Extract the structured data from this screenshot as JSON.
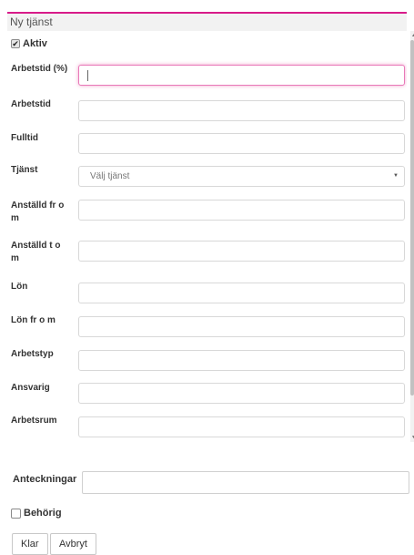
{
  "dialog": {
    "title": "Ny tjänst"
  },
  "form": {
    "active": {
      "label": "Aktiv",
      "checked": true
    },
    "fields": [
      {
        "label": "Arbetstid (%)",
        "value": "",
        "type": "text",
        "focused": true
      },
      {
        "label": "Arbetstid",
        "value": "",
        "type": "text"
      },
      {
        "label": "Fulltid",
        "value": "",
        "type": "text"
      },
      {
        "label": "Tjänst",
        "value": "Välj tjänst",
        "type": "select"
      },
      {
        "label": "Anställd fr o m",
        "value": "",
        "type": "text"
      },
      {
        "label": "Anställd t o m",
        "value": "",
        "type": "text"
      },
      {
        "label": "Lön",
        "value": "",
        "type": "text"
      },
      {
        "label": "Lön fr o m",
        "value": "",
        "type": "text"
      },
      {
        "label": "Arbetstyp",
        "value": "",
        "type": "text"
      },
      {
        "label": "Ansvarig",
        "value": "",
        "type": "text"
      },
      {
        "label": "Arbetsrum",
        "value": "",
        "type": "text"
      }
    ]
  },
  "notes": {
    "label": "Anteckningar",
    "value": ""
  },
  "qualified": {
    "label": "Behörig",
    "checked": false
  },
  "buttons": {
    "done": "Klar",
    "cancel": "Avbryt"
  },
  "colors": {
    "accent": "#d81b8a",
    "focus": "#e879b8"
  },
  "icons": {
    "check": "checkmark-icon",
    "select": "chevron-down-icon"
  }
}
